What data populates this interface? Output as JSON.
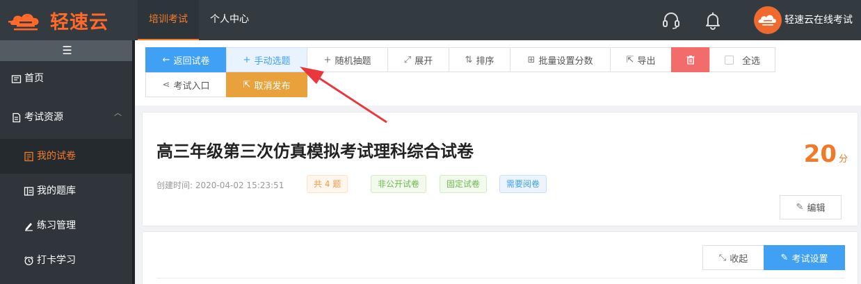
{
  "brand": {
    "name": "轻速云",
    "color": "#ff6a2b"
  },
  "topnav": {
    "items": [
      {
        "label": "培训考试",
        "active": true
      },
      {
        "label": "个人中心",
        "active": false
      }
    ],
    "icons": [
      "headset-icon",
      "bell-icon"
    ],
    "username": "轻速云在线考试"
  },
  "sidebar": {
    "toggle_icon": "☰",
    "items": [
      {
        "label": "首页",
        "icon": "home-icon"
      },
      {
        "label": "考试资源",
        "icon": "document-icon",
        "expanded": true
      },
      {
        "label": "我的试卷",
        "icon": "paper-icon",
        "active": true
      },
      {
        "label": "我的题库",
        "icon": "question-bank-icon"
      },
      {
        "label": "练习管理",
        "icon": "pen-icon"
      },
      {
        "label": "打卡学习",
        "icon": "alarm-icon"
      }
    ]
  },
  "toolbar": {
    "back": "返回试卷",
    "manual_select": "手动选题",
    "random_select": "随机抽题",
    "expand": "展开",
    "sort": "排序",
    "batch_score": "批量设置分数",
    "export": "导出",
    "select_all": "全选",
    "exam_entry": "考试入口",
    "unpublish": "取消发布"
  },
  "exam": {
    "title": "高三年级第三次仿真模拟考试理科综合试卷",
    "score_value": "20",
    "score_unit": "分",
    "created_label": "创建时间:",
    "created_time": "2020-04-02 15:23:51",
    "tags": [
      "共 4 题",
      "非公开试卷",
      "固定试卷",
      "需要阅卷"
    ],
    "edit": "编辑"
  },
  "panel2": {
    "collapse": "收起",
    "settings": "考试设置"
  },
  "colors": {
    "accent": "#f47c2a",
    "primary": "#3fa0f4",
    "danger": "#f36c6c",
    "warning": "#e9a23b",
    "annotation_arrow": "#e8383d"
  }
}
